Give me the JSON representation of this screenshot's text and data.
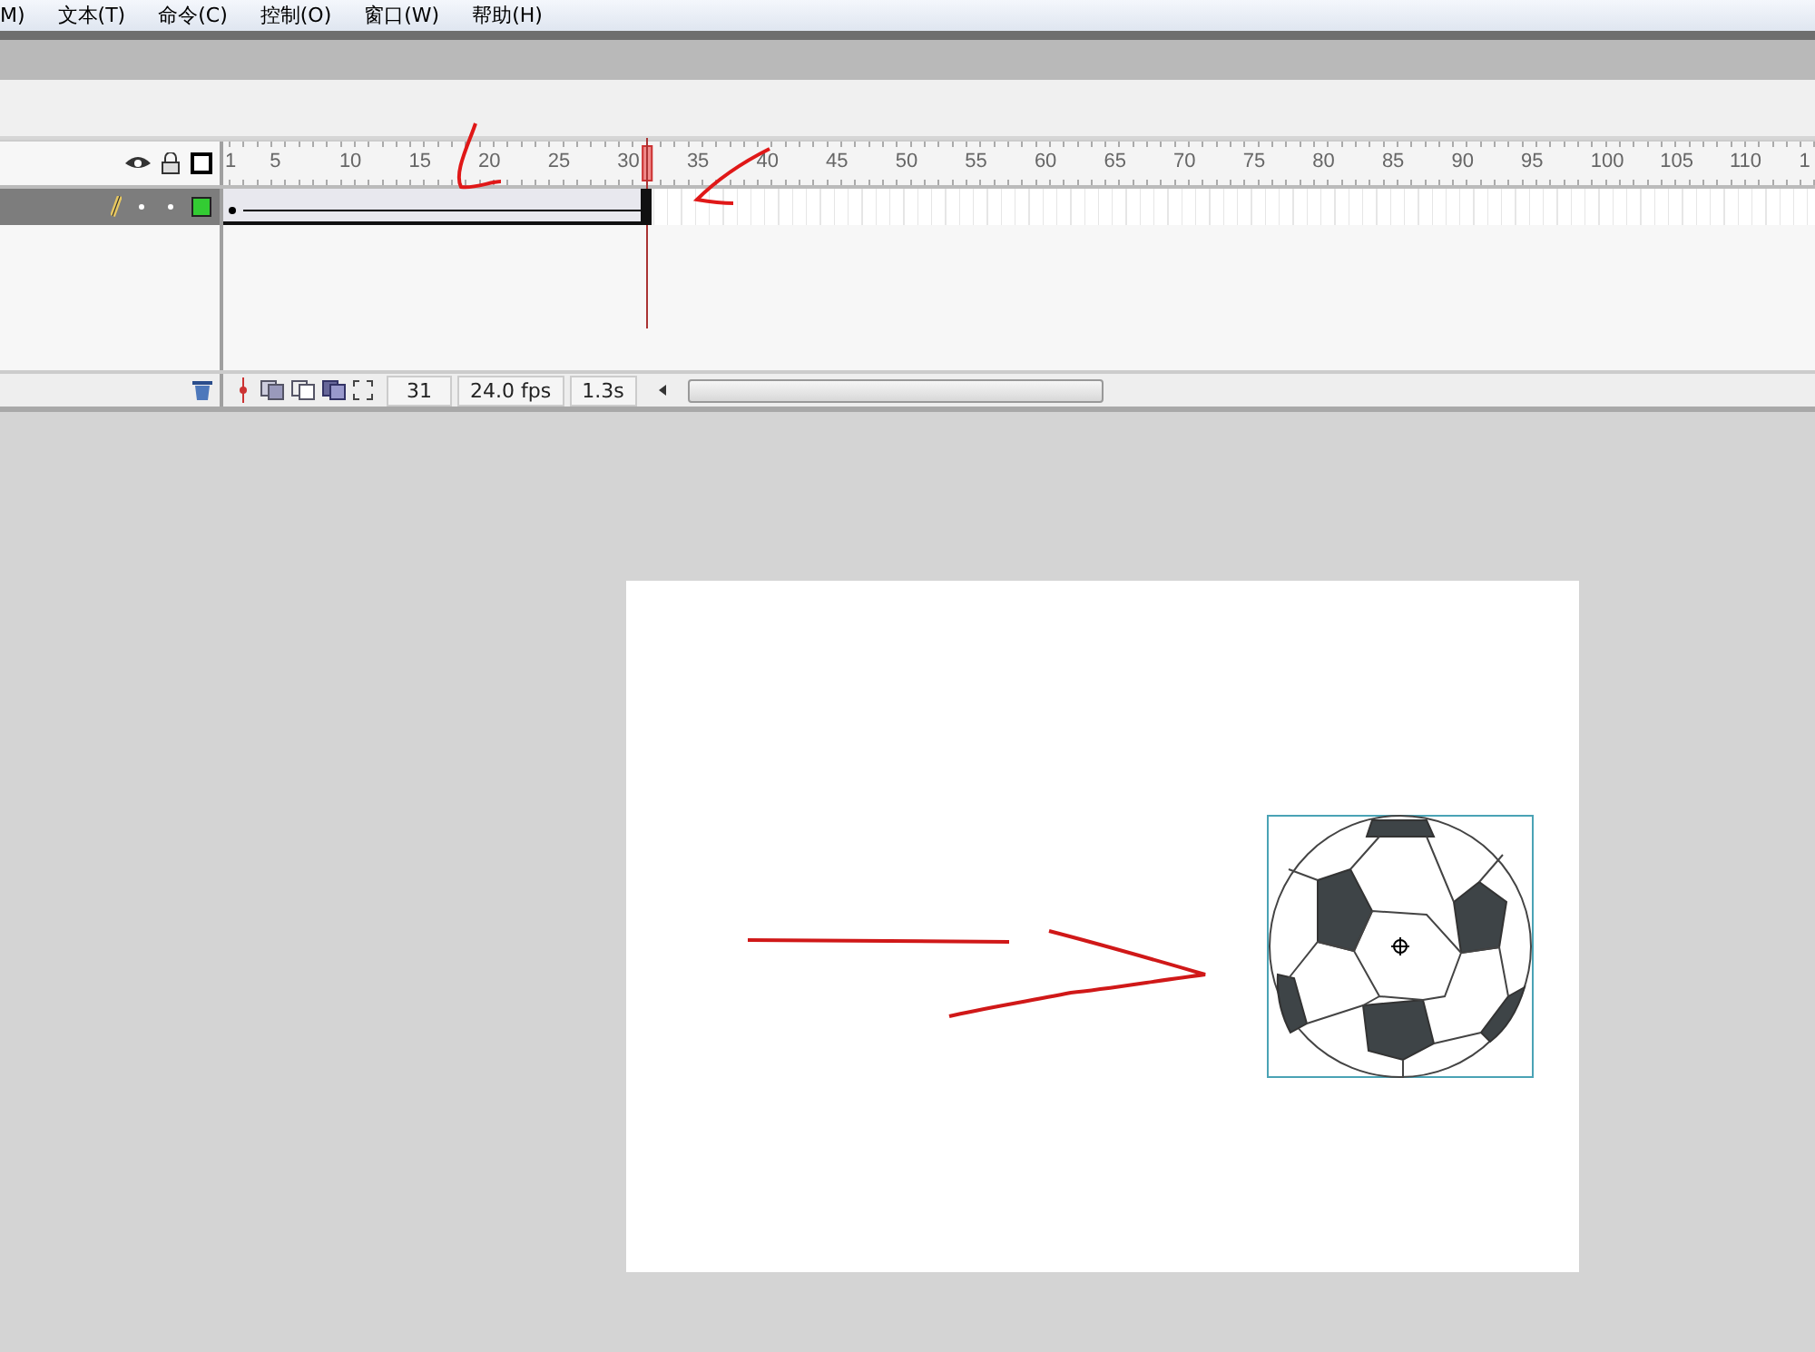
{
  "menu": [
    {
      "label": "M)"
    },
    {
      "label": "文本(T)"
    },
    {
      "label": "命令(C)"
    },
    {
      "label": "控制(O)"
    },
    {
      "label": "窗口(W)"
    },
    {
      "label": "帮助(H)"
    }
  ],
  "timeline": {
    "ruler_labels": [
      "1",
      "5",
      "10",
      "15",
      "20",
      "25",
      "30",
      "35",
      "40",
      "45",
      "50",
      "55",
      "60",
      "65",
      "70",
      "75",
      "80",
      "85",
      "90",
      "95",
      "100",
      "105",
      "110",
      "1"
    ],
    "playhead": {
      "level": 0.2667
    },
    "layer": {
      "selected": true,
      "tween": {
        "level": 0.2626
      }
    },
    "current_frame": "31",
    "frame_rate": "24.0 fps",
    "elapsed_time": "1.3s"
  }
}
